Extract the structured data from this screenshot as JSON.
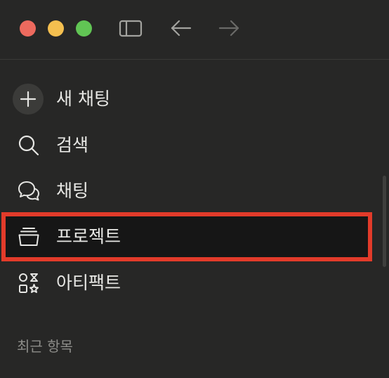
{
  "window": {
    "traffic_lights": {
      "close": "#ed6a5e",
      "minimize": "#f4bf4f",
      "maximize": "#61c554"
    },
    "toolbar_icons": [
      "sidebar-toggle-icon",
      "arrow-left-icon",
      "arrow-right-icon"
    ]
  },
  "sidebar": {
    "items": [
      {
        "label": "새 채팅",
        "icon": "plus-icon"
      },
      {
        "label": "검색",
        "icon": "search-icon"
      },
      {
        "label": "채팅",
        "icon": "chat-bubbles-icon"
      },
      {
        "label": "프로젝트",
        "icon": "project-box-icon",
        "highlighted": true
      },
      {
        "label": "아티팩트",
        "icon": "artifacts-shapes-icon"
      }
    ],
    "recent_title": "최근 항목"
  },
  "colors": {
    "highlight_border": "#e23b2a",
    "background": "#272726"
  }
}
